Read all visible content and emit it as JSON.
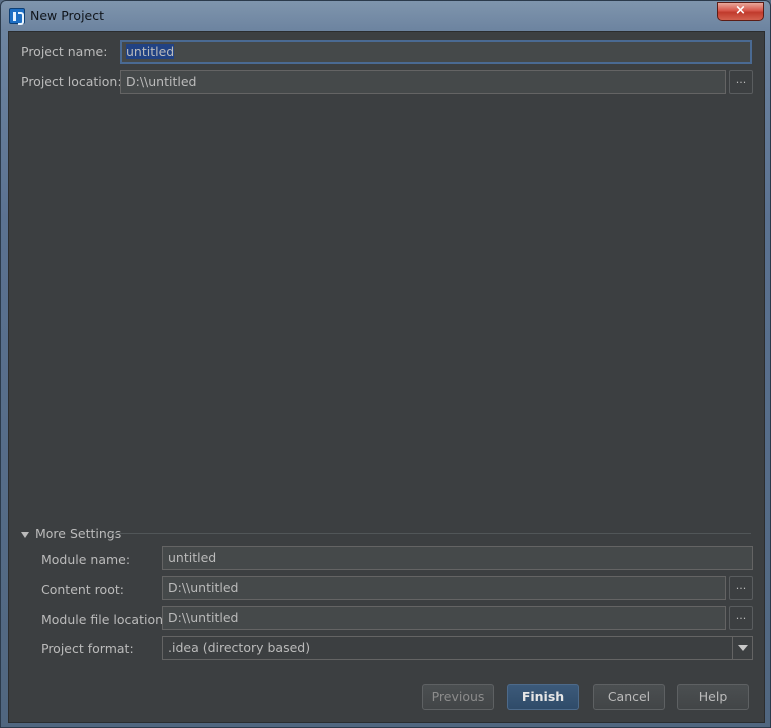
{
  "window": {
    "title": "New Project",
    "close_label": "×"
  },
  "project": {
    "name_label": "Project name:",
    "name_value": "untitled",
    "location_label": "Project location:",
    "location_value": "D:\\\\untitled",
    "browse_label": "..."
  },
  "more_settings": {
    "header": "More Settings",
    "module_name_label": "Module name:",
    "module_name_value": "untitled",
    "content_root_label": "Content root:",
    "content_root_value": "D:\\\\untitled",
    "module_file_label": "Module file location:",
    "module_file_value": "D:\\\\untitled",
    "format_label": "Project format:",
    "format_value": ".idea (directory based)"
  },
  "buttons": {
    "previous": "Previous",
    "finish": "Finish",
    "cancel": "Cancel",
    "help": "Help"
  },
  "colors": {
    "background": "#3c3f41",
    "field": "#45494a",
    "text": "#bbbbbb",
    "selection": "#214283",
    "default_button": "#2f4b69"
  },
  "icons": {
    "app": "intellij-idea-icon",
    "expand": "triangle-down-icon",
    "dropdown": "chevron-down-icon"
  }
}
